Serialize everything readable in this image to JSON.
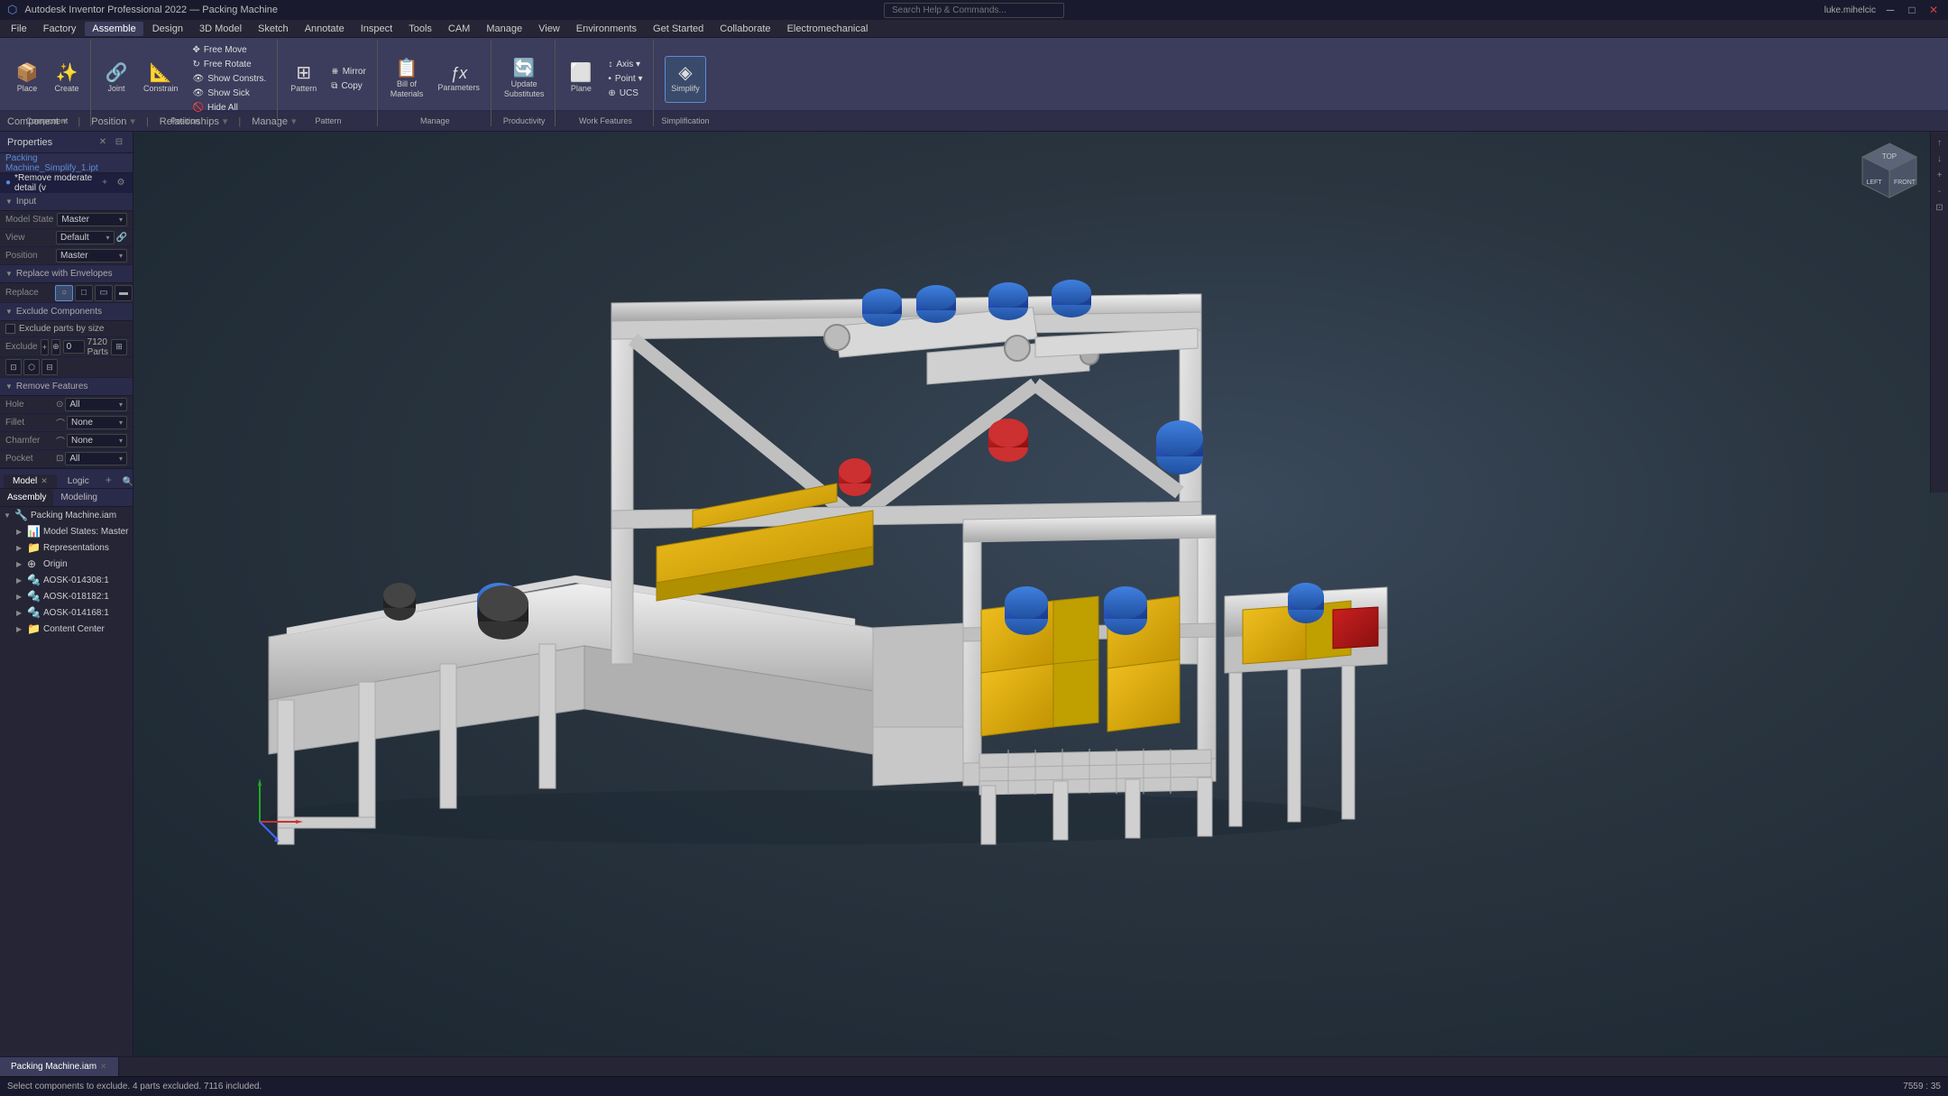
{
  "app": {
    "title": "Autodesk Inventor Professional 2022 — Packing Machine",
    "search_placeholder": "Search Help & Commands...",
    "user": "luke.mihelcic",
    "window_controls": [
      "minimize",
      "maximize",
      "close"
    ]
  },
  "menubar": {
    "items": [
      "File",
      "Factory",
      "Assemble",
      "Design",
      "3D Model",
      "Sketch",
      "Annotate",
      "Inspect",
      "Tools",
      "CAM",
      "Manage",
      "View",
      "Environments",
      "Get Started",
      "Collaborate",
      "Electromechanical"
    ]
  },
  "ribbon": {
    "active_tab": "Assemble",
    "tabs": [
      "File",
      "Factory",
      "Assemble",
      "Design",
      "3D Model",
      "Sketch",
      "Annotate",
      "Inspect",
      "Tools",
      "CAM",
      "Manage",
      "View",
      "Environments",
      "Get Started",
      "Collaborate",
      "Electromechanical"
    ],
    "groups": [
      {
        "name": "Component",
        "buttons": [
          {
            "id": "place",
            "label": "Place",
            "icon": "📦"
          },
          {
            "id": "create",
            "label": "Create",
            "icon": "✨"
          }
        ]
      },
      {
        "name": "Position",
        "buttons": [
          {
            "id": "free-move",
            "label": "Free Move",
            "icon": "✥"
          },
          {
            "id": "free-rotate",
            "label": "Free Rotate",
            "icon": "↻"
          },
          {
            "id": "joint",
            "label": "Joint",
            "icon": "🔗"
          },
          {
            "id": "constrain",
            "label": "Constrain",
            "icon": "📐"
          },
          {
            "id": "show-constraints",
            "label": "Show Constrs.",
            "icon": "👁"
          },
          {
            "id": "show-sick",
            "label": "Show Sick",
            "icon": "👁"
          },
          {
            "id": "hide-all",
            "label": "Hide All",
            "icon": "🚫"
          }
        ]
      },
      {
        "name": "Pattern",
        "buttons": [
          {
            "id": "pattern",
            "label": "Pattern",
            "icon": "⊞"
          },
          {
            "id": "mirror",
            "label": "Mirror",
            "icon": "⧻"
          },
          {
            "id": "copy",
            "label": "Copy",
            "icon": "⧉"
          }
        ]
      },
      {
        "name": "Manage",
        "buttons": [
          {
            "id": "bill-of-materials",
            "label": "Bill of Materials",
            "icon": "📋"
          },
          {
            "id": "parameters",
            "label": "Parameters",
            "icon": "ƒx"
          }
        ]
      },
      {
        "name": "Productivity",
        "buttons": [
          {
            "id": "update-substitutes",
            "label": "Update Substitutes",
            "icon": "🔄"
          }
        ]
      },
      {
        "name": "Work Features",
        "buttons": [
          {
            "id": "axis",
            "label": "Axis",
            "icon": "↕"
          },
          {
            "id": "plane",
            "label": "Plane",
            "icon": "⬜"
          },
          {
            "id": "point",
            "label": "Point",
            "icon": "•"
          },
          {
            "id": "ucs",
            "label": "UCS",
            "icon": "⊕"
          }
        ]
      },
      {
        "name": "Simplification",
        "buttons": [
          {
            "id": "simplify",
            "label": "Simplify",
            "icon": "◈"
          }
        ]
      }
    ]
  },
  "contextbar": {
    "component_label": "Component",
    "position_label": "Position",
    "relationships_label": "Relationships",
    "manage_label": "Manage"
  },
  "properties_panel": {
    "title": "Properties",
    "file_name": "Packing Machine_Simplify_1.ipt",
    "constraint_name": "*Remove moderate detail (v",
    "sections": {
      "input": {
        "label": "Input",
        "model_state": {
          "label": "Model State",
          "value": "Master"
        },
        "view": {
          "label": "View",
          "value": "Default"
        },
        "position": {
          "label": "Position",
          "value": "Master"
        }
      },
      "replace_with_envelopes": {
        "label": "Replace with Envelopes",
        "replace_label": "Replace",
        "buttons": [
          "circle",
          "square",
          "outline",
          "fill",
          "dropdown"
        ]
      },
      "exclude_components": {
        "label": "Exclude Components",
        "exclude_parts_by_size_label": "Exclude parts by size",
        "exclude_label": "Exclude",
        "parts_count": "7120 Parts"
      },
      "remove_features": {
        "label": "Remove Features",
        "hole": {
          "label": "Hole",
          "value": "All"
        },
        "fillet": {
          "label": "Fillet",
          "value": "None"
        },
        "chamfer": {
          "label": "Chamfer",
          "value": "None"
        },
        "pocket": {
          "label": "Pocket",
          "value": "All"
        }
      }
    }
  },
  "model_tree": {
    "tabs": [
      {
        "label": "Model",
        "active": true
      },
      {
        "label": "Logic",
        "active": false
      }
    ],
    "sub_tabs": [
      {
        "label": "Assembly",
        "active": true
      },
      {
        "label": "Modeling",
        "active": false
      }
    ],
    "items": [
      {
        "id": "packing-machine",
        "label": "Packing Machine.iam",
        "indent": 0,
        "icon": "🔧",
        "expanded": true
      },
      {
        "id": "model-states",
        "label": "Model States: Master",
        "indent": 1,
        "icon": "📊",
        "expanded": false
      },
      {
        "id": "representations",
        "label": "Representations",
        "indent": 1,
        "icon": "📁",
        "expanded": false
      },
      {
        "id": "origin",
        "label": "Origin",
        "indent": 1,
        "icon": "⊕",
        "expanded": false
      },
      {
        "id": "aosk-014308",
        "label": "AOSK-014308:1",
        "indent": 1,
        "icon": "🔩",
        "expanded": false
      },
      {
        "id": "aosk-018182",
        "label": "AOSK-018182:1",
        "indent": 1,
        "icon": "🔩",
        "expanded": false
      },
      {
        "id": "aosk-014168",
        "label": "AOSK-014168:1",
        "indent": 1,
        "icon": "🔩",
        "expanded": false
      },
      {
        "id": "content-center",
        "label": "Content Center",
        "indent": 1,
        "icon": "📁",
        "expanded": false
      }
    ]
  },
  "viewport": {
    "model_name": "Packing Machine",
    "background_color": "#2a3540"
  },
  "statusbar": {
    "message": "Select components to exclude. 4 parts excluded. 7116 included.",
    "coords": "7559 : 35"
  },
  "bottombar": {
    "tabs": [
      {
        "label": "Packing Machine.iam",
        "active": true,
        "closable": true
      }
    ]
  },
  "icons": {
    "collapse": "▼",
    "expand": "▶",
    "close": "✕",
    "dropdown": "▾",
    "search": "🔍",
    "plus": "+",
    "settings": "⚙",
    "pin": "📌",
    "link": "🔗",
    "minimize": "─",
    "maximize": "□",
    "eye": "👁",
    "lock": "🔒"
  }
}
